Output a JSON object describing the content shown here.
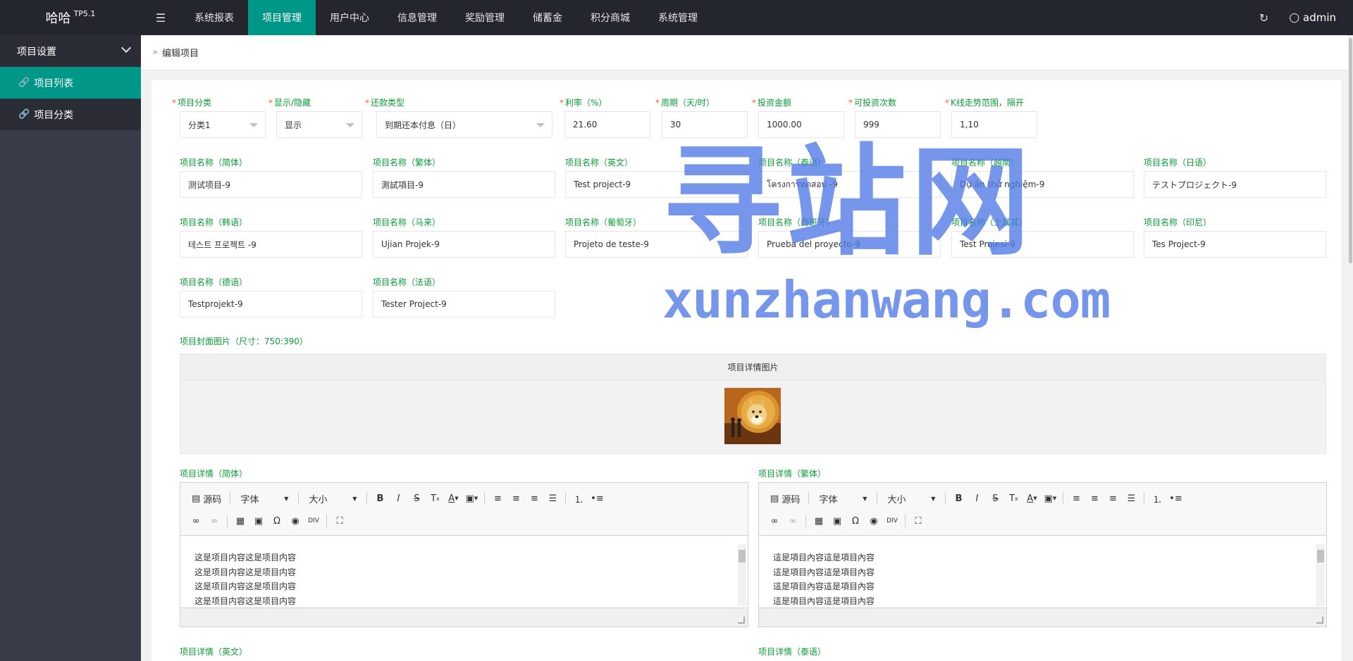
{
  "header": {
    "logo": "哈哈",
    "logo_sup": "TP5.1",
    "menu_toggle_glyph": "☰",
    "nav": [
      {
        "label": "系统报表",
        "active": false
      },
      {
        "label": "项目管理",
        "active": true
      },
      {
        "label": "用户中心",
        "active": false
      },
      {
        "label": "信息管理",
        "active": false
      },
      {
        "label": "奖励管理",
        "active": false
      },
      {
        "label": "储蓄金",
        "active": false
      },
      {
        "label": "积分商城",
        "active": false
      },
      {
        "label": "系统管理",
        "active": false
      }
    ],
    "refresh_glyph": "↻",
    "user": "admin"
  },
  "sidebar": {
    "group": "项目设置",
    "items": [
      {
        "label": "项目列表",
        "active": true
      },
      {
        "label": "项目分类",
        "active": false
      }
    ]
  },
  "breadcrumb": {
    "glyph": "»",
    "current": "编辑项目"
  },
  "form": {
    "row1": [
      {
        "label": "项目分类",
        "value": "分类1",
        "type": "select"
      },
      {
        "label": "显示/隐藏",
        "value": "显示",
        "type": "select"
      },
      {
        "label": "还款类型",
        "value": "到期还本付息（日）",
        "type": "select"
      },
      {
        "label": "利率（%）",
        "value": "21.60",
        "type": "input"
      },
      {
        "label": "周期（天/时）",
        "value": "30",
        "type": "input"
      },
      {
        "label": "投资金额",
        "value": "1000.00",
        "type": "input"
      },
      {
        "label": "可投资次数",
        "value": "999",
        "type": "input"
      },
      {
        "label": "K线走势范围，隔开",
        "value": "1,10",
        "type": "input"
      }
    ],
    "names": [
      {
        "label": "项目名称（简体）",
        "value": "测试项目-9"
      },
      {
        "label": "项目名称（繁体）",
        "value": "測試項目-9"
      },
      {
        "label": "项目名称（英文）",
        "value": "Test project-9"
      },
      {
        "label": "项目名称（泰语）",
        "value": "โครงการทดสอบ -9"
      },
      {
        "label": "项目名称（越南）",
        "value": "Dự án thử nghiệm-9"
      },
      {
        "label": "项目名称（日语）",
        "value": "テストプロジェクト-9"
      },
      {
        "label": "项目名称（韩语）",
        "value": "테스트 프로젝트 -9"
      },
      {
        "label": "项目名称（马来）",
        "value": "Ujian Projek-9"
      },
      {
        "label": "项目名称（葡萄牙）",
        "value": "Projeto de teste-9"
      },
      {
        "label": "项目名称（西班牙）",
        "value": "Prueba del proyecto-9"
      },
      {
        "label": "项目名称（土耳其）",
        "value": "Test Projesi-9"
      },
      {
        "label": "项目名称（印尼）",
        "value": "Tes Project-9"
      },
      {
        "label": "项目名称（德语）",
        "value": "Testprojekt-9"
      },
      {
        "label": "项目名称（法语）",
        "value": "Tester Project-9"
      }
    ],
    "cover_label": "项目封面图片（尺寸：750:390）",
    "cover_caption": "项目详情图片",
    "editors": [
      {
        "label": "项目详情（简体）",
        "lines": [
          "这是项目内容这是项目内容",
          "这是项目内容这是项目内容",
          "这是项目内容这是项目内容",
          "这是项目内容这是项目内容"
        ]
      },
      {
        "label": "项目详情（繁体）",
        "lines": [
          "這是項目內容這是項目內容",
          "這是項目內容這是項目內容",
          "這是項目內容這是項目內容",
          "這是項目內容這是項目內容"
        ]
      }
    ],
    "editor_toolbar": {
      "source": "源码",
      "font": "字体",
      "size": "大小"
    },
    "next_labels": [
      "项目详情（英文）",
      "项目详情（泰语）"
    ]
  },
  "watermark": {
    "cn": "寻站网",
    "en": "xunzhanwang.com"
  },
  "colors": {
    "accent": "#009688",
    "header_bg": "#23262e",
    "sidebar_bg": "#393d49",
    "label_green": "#0a9d36",
    "required": "#ff5722"
  }
}
